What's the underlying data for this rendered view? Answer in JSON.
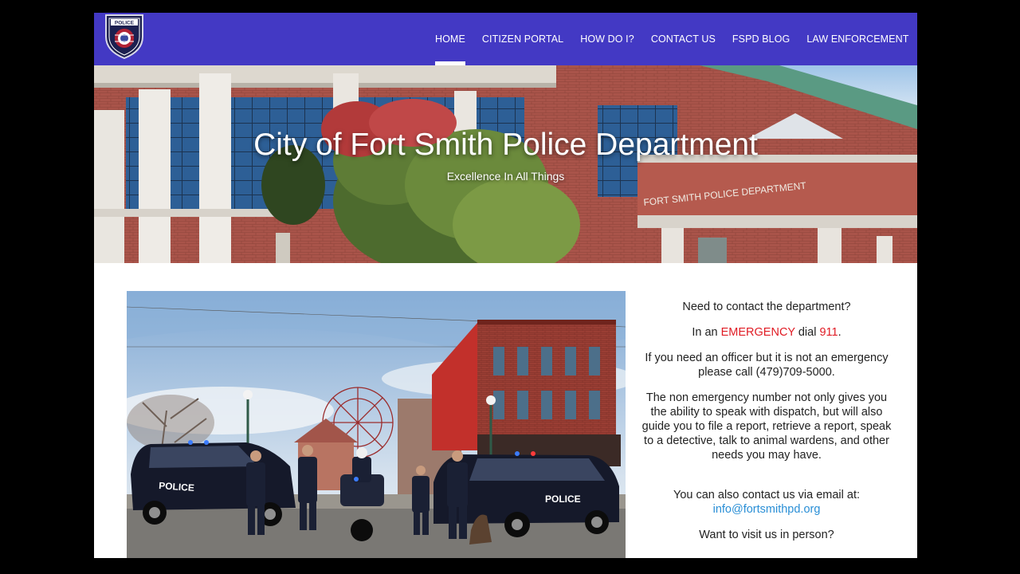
{
  "nav": {
    "items": [
      {
        "label": "HOME",
        "active": true
      },
      {
        "label": "CITIZEN PORTAL"
      },
      {
        "label": "HOW DO I?"
      },
      {
        "label": "CONTACT US"
      },
      {
        "label": "FSPD BLOG"
      },
      {
        "label": "LAW ENFORCEMENT"
      }
    ],
    "logo_text": "POLICE"
  },
  "hero": {
    "title": "City of Fort Smith Police Department",
    "subtitle": "Excellence In All Things",
    "sign_text": "FORT SMITH POLICE DEPARTMENT"
  },
  "photo": {
    "car_label": "POLICE"
  },
  "info": {
    "intro": "Need to contact the department?",
    "emergency_prefix": "In an ",
    "emergency_word": "EMERGENCY",
    "emergency_mid": " dial ",
    "emergency_number": "911",
    "emergency_suffix": ".",
    "non_emergency": "If you need an officer but it is not an emergency please call (479)709-5000.",
    "details": "The non emergency number not only gives you the ability to speak with dispatch, but will also guide you to file a report, retrieve a report, speak to a detective, talk to animal wardens, and other needs you may have.",
    "email_intro": "You can also contact us via email at:",
    "email": "info@fortsmithpd.org",
    "visit": "Want to visit us in person?"
  },
  "colors": {
    "nav_bg": "#4339c4",
    "emergency": "#e01b24",
    "link": "#2a8fd6"
  }
}
